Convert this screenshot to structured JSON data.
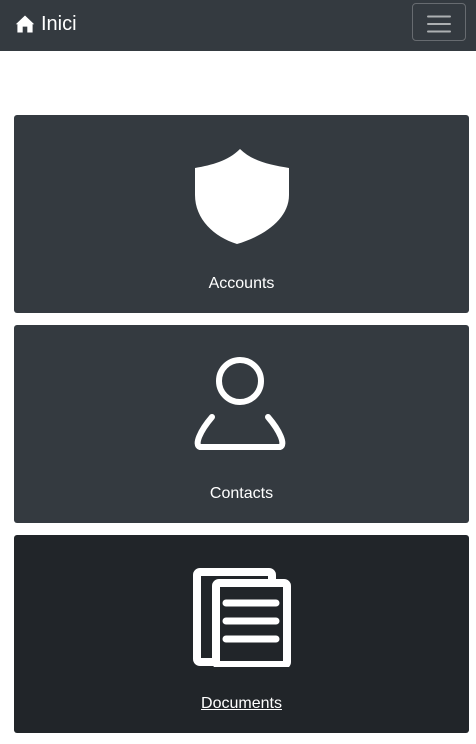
{
  "navbar": {
    "brand_label": "Inici",
    "brand_icon": "home-icon",
    "toggler_icon": "hamburger-menu-icon",
    "background": "#343a40"
  },
  "tiles": [
    {
      "label": "Accounts",
      "icon": "shield-icon",
      "background": "#343a40"
    },
    {
      "label": "Contacts",
      "icon": "user-icon",
      "background": "#343a40"
    },
    {
      "label": "Documents",
      "icon": "documents-icon",
      "background": "#212529",
      "active": true
    }
  ]
}
